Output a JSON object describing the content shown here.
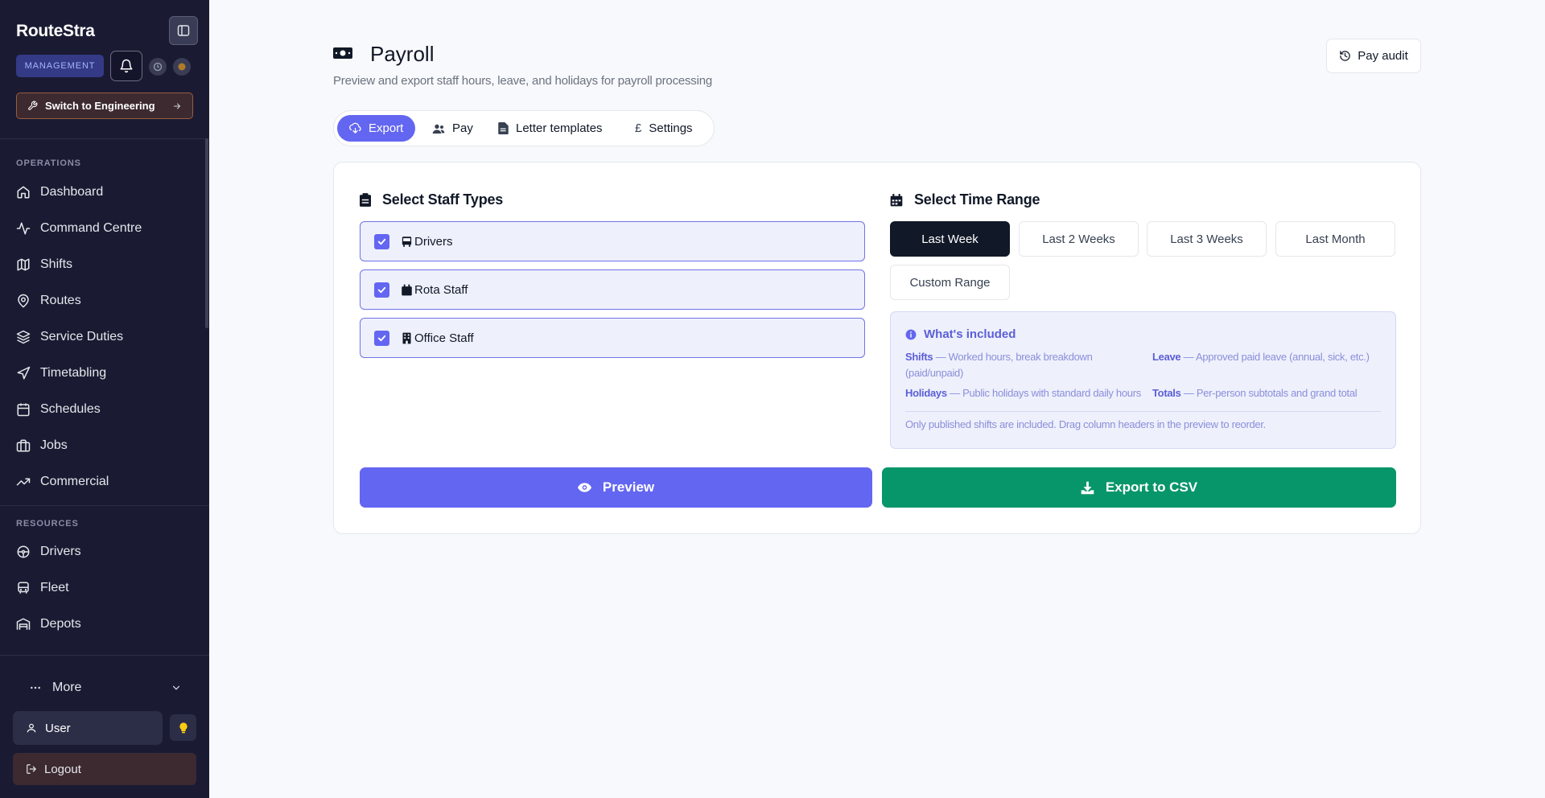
{
  "sidebar": {
    "brand": "RouteStra",
    "badge": "MANAGEMENT",
    "switch_label": "Switch to Engineering",
    "operations_label": "OPERATIONS",
    "operations": [
      {
        "label": "Dashboard",
        "icon": "home-icon"
      },
      {
        "label": "Command Centre",
        "icon": "activity-icon"
      },
      {
        "label": "Shifts",
        "icon": "map-icon"
      },
      {
        "label": "Routes",
        "icon": "map-pin-icon"
      },
      {
        "label": "Service Duties",
        "icon": "layers-icon"
      },
      {
        "label": "Timetabling",
        "icon": "navigation-icon"
      },
      {
        "label": "Schedules",
        "icon": "calendar-icon"
      },
      {
        "label": "Jobs",
        "icon": "briefcase-icon"
      },
      {
        "label": "Commercial",
        "icon": "trending-up-icon"
      }
    ],
    "resources_label": "RESOURCES",
    "resources": [
      {
        "label": "Drivers",
        "icon": "steering-wheel-icon"
      },
      {
        "label": "Fleet",
        "icon": "bus-icon"
      },
      {
        "label": "Depots",
        "icon": "warehouse-icon"
      }
    ],
    "more_label": "More",
    "user_label": "User",
    "logout_label": "Logout"
  },
  "header": {
    "title": "Payroll",
    "subtitle": "Preview and export staff hours, leave, and holidays for payroll processing",
    "audit_label": "Pay audit"
  },
  "tabs": [
    {
      "label": "Export",
      "active": true
    },
    {
      "label": "Pay",
      "active": false
    },
    {
      "label": "Letter templates",
      "active": false
    },
    {
      "label": "Settings",
      "active": false
    }
  ],
  "staff": {
    "heading": "Select Staff Types",
    "items": [
      {
        "label": "Drivers",
        "checked": true
      },
      {
        "label": "Rota Staff",
        "checked": true
      },
      {
        "label": "Office Staff",
        "checked": true
      }
    ]
  },
  "range": {
    "heading": "Select Time Range",
    "options": [
      "Last Week",
      "Last 2 Weeks",
      "Last 3 Weeks",
      "Last Month",
      "Custom Range"
    ],
    "selected": "Last Week"
  },
  "info": {
    "heading": "What's included",
    "items": [
      {
        "term": "Shifts",
        "desc": " — Worked hours, break breakdown (paid/unpaid)"
      },
      {
        "term": "Leave",
        "desc": " — Approved paid leave (annual, sick, etc.)"
      },
      {
        "term": "Holidays",
        "desc": " — Public holidays with standard daily hours"
      },
      {
        "term": "Totals",
        "desc": " — Per-person subtotals and grand total"
      }
    ],
    "note": "Only published shifts are included. Drag column headers in the preview to reorder."
  },
  "actions": {
    "preview_label": "Preview",
    "export_label": "Export to CSV"
  },
  "colors": {
    "accent": "#6366f1",
    "export": "#079669",
    "sidebar": "#1a1b33",
    "dark_button": "#111827"
  }
}
